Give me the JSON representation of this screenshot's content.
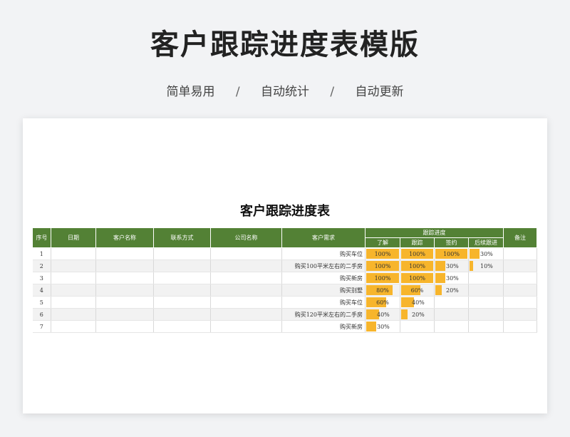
{
  "banner": {
    "title": "客户跟踪进度表模版",
    "features": [
      "简单易用",
      "自动统计",
      "自动更新"
    ],
    "separator": "/"
  },
  "sheet": {
    "title": "客户跟踪进度表",
    "headers": {
      "index": "序号",
      "date": "日期",
      "customer": "客户名称",
      "contact": "联系方式",
      "company": "公司名称",
      "need": "客户需求",
      "progress": "跟踪进度",
      "stages": [
        "了解",
        "跟踪",
        "签约",
        "后续跟进"
      ],
      "remark": "备注"
    },
    "rows": [
      {
        "index": "1",
        "need": "购买车位",
        "progress": [
          100,
          100,
          100,
          30
        ]
      },
      {
        "index": "2",
        "need": "购买100平米左右的二手房",
        "progress": [
          100,
          100,
          30,
          10
        ]
      },
      {
        "index": "3",
        "need": "购买新房",
        "progress": [
          100,
          100,
          30,
          null
        ]
      },
      {
        "index": "4",
        "need": "购买别墅",
        "progress": [
          80,
          60,
          20,
          null
        ]
      },
      {
        "index": "5",
        "need": "购买车位",
        "progress": [
          60,
          40,
          null,
          null
        ]
      },
      {
        "index": "6",
        "need": "购买120平米左右的二手房",
        "progress": [
          40,
          20,
          null,
          null
        ]
      },
      {
        "index": "7",
        "need": "购买新房",
        "progress": [
          30,
          null,
          null,
          null
        ]
      }
    ],
    "bar_color": "#f7b52c",
    "header_color": "#538135"
  }
}
